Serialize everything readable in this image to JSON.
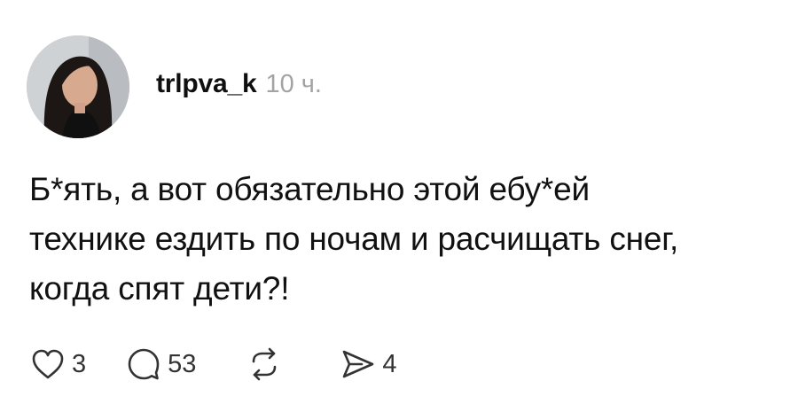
{
  "post": {
    "author": {
      "username": "trlpva_k",
      "timestamp": "10 ч."
    },
    "text_lines": [
      "Б*ять, а вот обязательно этой ебу*ей",
      "технике ездить по ночам и расчищать снег,",
      "когда спят дети?!"
    ],
    "actions": {
      "like_count": "3",
      "comment_count": "53",
      "share_count": "4"
    }
  },
  "icons": {
    "like": "heart-icon",
    "comment": "speech-bubble-icon",
    "repost": "repost-arrows-icon",
    "share": "send-icon"
  },
  "colors": {
    "text": "#111111",
    "timestamp": "#a3a3a3",
    "icon": "#333333",
    "background": "#ffffff"
  }
}
